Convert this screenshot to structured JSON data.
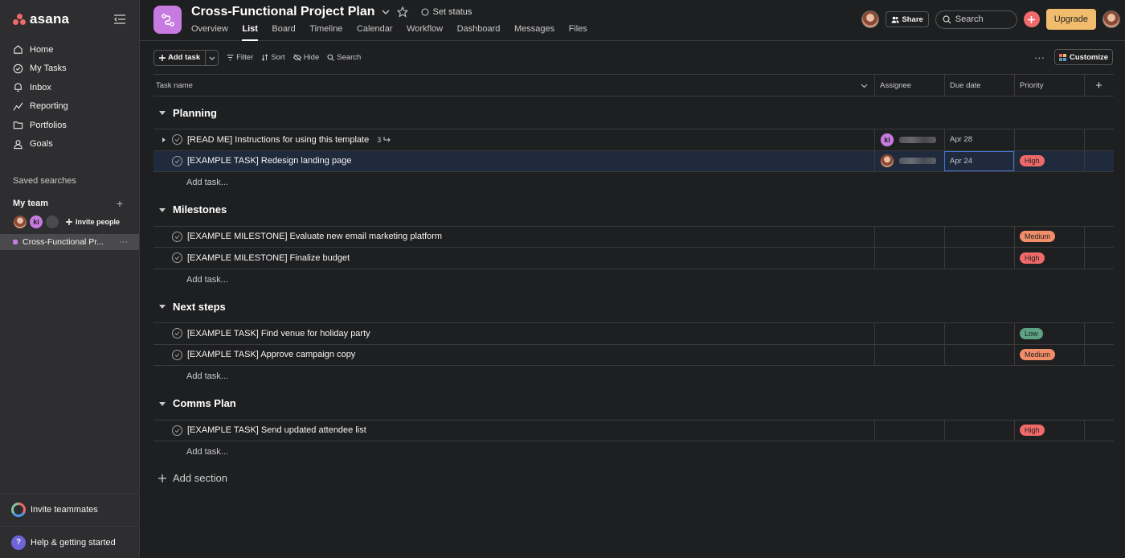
{
  "app": {
    "logo_text": "asana"
  },
  "sidebar": {
    "nav": [
      {
        "label": "Home",
        "icon": "home-icon"
      },
      {
        "label": "My Tasks",
        "icon": "check-circle-icon"
      },
      {
        "label": "Inbox",
        "icon": "bell-icon"
      },
      {
        "label": "Reporting",
        "icon": "trend-icon"
      },
      {
        "label": "Portfolios",
        "icon": "folder-icon"
      },
      {
        "label": "Goals",
        "icon": "person-icon"
      }
    ],
    "saved_searches": "Saved searches",
    "team": {
      "name": "My team",
      "add": "+",
      "invite": "Invite people",
      "member_initials": "ki"
    },
    "project": {
      "name": "Cross-Functional Pr...",
      "more": "···"
    },
    "invite_teammates": "Invite teammates",
    "help": "Help & getting started",
    "help_glyph": "?"
  },
  "header": {
    "title": "Cross-Functional Project Plan",
    "set_status": "Set status",
    "tabs": [
      "Overview",
      "List",
      "Board",
      "Timeline",
      "Calendar",
      "Workflow",
      "Dashboard",
      "Messages",
      "Files"
    ],
    "active_tab": "List",
    "share": "Share",
    "search_placeholder": "Search",
    "upgrade": "Upgrade"
  },
  "toolbar": {
    "add_task": "Add task",
    "filter": "Filter",
    "sort": "Sort",
    "hide": "Hide",
    "search": "Search",
    "customize": "Customize",
    "more": "···"
  },
  "columns": {
    "task": "Task name",
    "assignee": "Assignee",
    "due": "Due date",
    "priority": "Priority",
    "add": "+"
  },
  "sections": [
    {
      "name": "Planning",
      "tasks": [
        {
          "name": "[READ ME] Instructions for using this template",
          "subtasks": "3",
          "assignee": "ki",
          "due": "Apr 28",
          "priority": ""
        },
        {
          "name": "[EXAMPLE TASK] Redesign landing page",
          "assignee": "photo",
          "due": "Apr 24",
          "priority": "High",
          "selected": true
        }
      ]
    },
    {
      "name": "Milestones",
      "tasks": [
        {
          "name": "[EXAMPLE MILESTONE] Evaluate new email marketing platform",
          "priority": "Medium"
        },
        {
          "name": "[EXAMPLE MILESTONE] Finalize budget",
          "priority": "High"
        }
      ]
    },
    {
      "name": "Next steps",
      "tasks": [
        {
          "name": "[EXAMPLE TASK] Find venue for holiday party",
          "priority": "Low"
        },
        {
          "name": "[EXAMPLE TASK] Approve campaign copy",
          "priority": "Medium"
        }
      ]
    },
    {
      "name": "Comms Plan",
      "tasks": [
        {
          "name": "[EXAMPLE TASK] Send updated attendee list",
          "priority": "High"
        }
      ]
    }
  ],
  "add_task_label": "Add task...",
  "add_section": "Add section",
  "colors": {
    "brand": "#f06a6a",
    "project": "#c77be0",
    "upgrade": "#f1bd6c",
    "high": "#f06a6a",
    "medium": "#f28d6a",
    "low": "#5da283"
  }
}
